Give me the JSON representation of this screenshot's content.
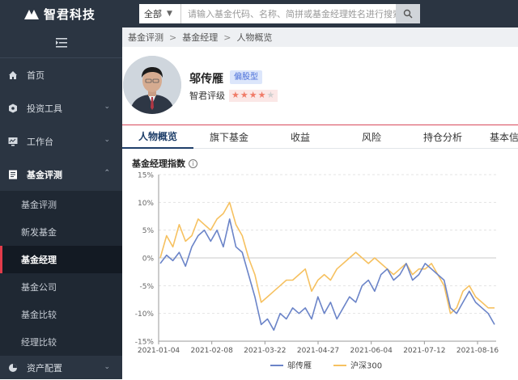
{
  "header": {
    "logo_text": "智君科技",
    "search_scope": "全部",
    "search_placeholder": "请输入基金代码、名称、简拼或基金经理姓名进行搜索"
  },
  "sidebar": {
    "items": [
      {
        "label": "首页",
        "icon": "home-icon"
      },
      {
        "label": "投资工具",
        "icon": "tools-icon"
      },
      {
        "label": "工作台",
        "icon": "monitor-icon"
      },
      {
        "label": "基金评测",
        "icon": "document-icon"
      }
    ],
    "sub_items": [
      "基金评测",
      "新发基金",
      "基金经理",
      "基金公司",
      "基金比较",
      "经理比较"
    ],
    "active_sub": "基金经理",
    "last_item": "资产配置"
  },
  "breadcrumb": [
    "基金评测",
    "基金经理",
    "人物概览"
  ],
  "profile": {
    "name": "邬传雁",
    "tag": "偏股型",
    "rating_label": "智君评级",
    "stars": 4,
    "star_max": 5
  },
  "tabs": [
    "人物概览",
    "旗下基金",
    "收益",
    "风险",
    "持仓分析",
    "基本信"
  ],
  "colors": {
    "primary": "#1f3f6a",
    "series_a": "#6b84c8",
    "series_b": "#f6c160",
    "star": "#f07a67",
    "nav_bg": "#2b3542"
  },
  "chart_data": {
    "type": "line",
    "title": "基金经理指数",
    "ylim": [
      -15,
      15
    ],
    "y_ticks": [
      "15%",
      "10%",
      "5%",
      "0%",
      "-5%",
      "-10%",
      "-15%"
    ],
    "x_ticks": [
      "2021-01-04",
      "2021-02-08",
      "2021-03-22",
      "2021-04-27",
      "2021-06-04",
      "2021-07-12",
      "2021-08-16"
    ],
    "legend": "bottom-center",
    "grid": "horizontal-dashed",
    "series": [
      {
        "name": "邬传雁",
        "color": "#6b84c8",
        "values": [
          -1,
          0.5,
          -0.5,
          1,
          -1.5,
          2,
          4,
          5,
          3,
          5,
          2,
          7,
          2,
          1,
          -3,
          -7,
          -12,
          -11,
          -13,
          -10,
          -11,
          -9,
          -10,
          -9,
          -11,
          -7,
          -10,
          -8,
          -11,
          -9,
          -7,
          -8,
          -5,
          -4,
          -6,
          -3,
          -2,
          -4,
          -3,
          -1,
          -4,
          -3,
          -1,
          -2,
          -3,
          -4,
          -9,
          -10,
          -8,
          -6,
          -8,
          -9,
          -10,
          -12
        ]
      },
      {
        "name": "沪深300",
        "color": "#f6c160",
        "values": [
          0,
          4,
          2,
          6,
          3,
          4,
          7,
          6,
          5,
          7,
          8,
          10,
          6,
          4,
          0,
          -3,
          -8,
          -7,
          -6,
          -5,
          -4,
          -4,
          -3,
          -2,
          -6,
          -4,
          -3,
          -4,
          -2,
          -1,
          0,
          1,
          0,
          -1,
          0,
          -1,
          -2,
          -3,
          -2,
          -1,
          -3,
          -2,
          -2,
          -1,
          -3,
          -5,
          -10,
          -9,
          -6,
          -5,
          -7,
          -8,
          -9,
          -9
        ]
      }
    ]
  }
}
